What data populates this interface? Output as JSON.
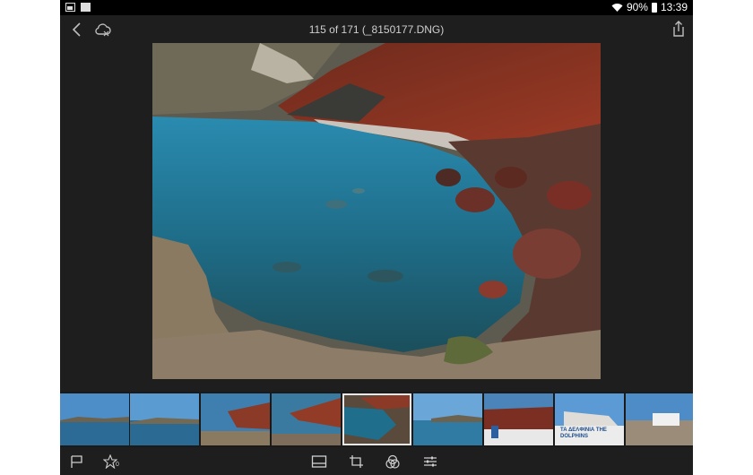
{
  "status_bar": {
    "battery_text": "90%",
    "time": "13:39",
    "icons": [
      "gallery-icon",
      "gmail-icon",
      "wifi-icon",
      "battery-icon"
    ]
  },
  "header": {
    "title": "115 of 171 (_8150177.DNG)",
    "icons": [
      "back-icon",
      "cloud-sync-icon",
      "share-icon"
    ]
  },
  "viewer": {
    "description_colors": {
      "water": "#1e6f8c",
      "cliff": "#8a2f1f",
      "rocks": "#6b3a2c",
      "sand": "#8a7a66"
    }
  },
  "filmstrip": {
    "thumbnails": [
      {
        "id": "thumb-1",
        "selected": false
      },
      {
        "id": "thumb-2",
        "selected": false
      },
      {
        "id": "thumb-3",
        "selected": false
      },
      {
        "id": "thumb-4",
        "selected": false
      },
      {
        "id": "thumb-5",
        "selected": true
      },
      {
        "id": "thumb-6",
        "selected": false
      },
      {
        "id": "thumb-7",
        "selected": false
      },
      {
        "id": "thumb-8",
        "selected": false
      },
      {
        "id": "thumb-9",
        "selected": false
      }
    ],
    "thumb_8_caption": "TA ΔΕΛΦΙΝΙΑ THE DOLPHINS"
  },
  "toolbar": {
    "rating_count": "0",
    "icons": [
      "flag-icon",
      "star-icon",
      "filmstrip-view-icon",
      "crop-icon",
      "presets-icon",
      "adjust-sliders-icon"
    ]
  }
}
